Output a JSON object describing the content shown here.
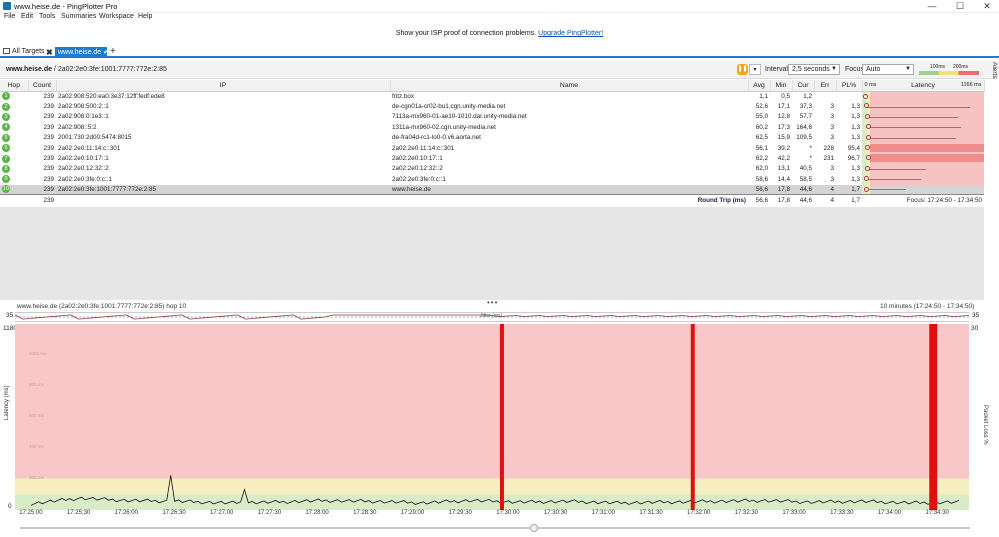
{
  "window": {
    "title": "www.heise.de - PingPlotter Pro",
    "min_glyph": "—",
    "max_glyph": "☐",
    "close_glyph": "✕"
  },
  "menu": [
    "File",
    "Edit",
    "Tools",
    "Summaries",
    "Workspace",
    "Help"
  ],
  "banner": {
    "text": "Show your ISP proof of connection problems.",
    "link": "Upgrade PingPlotter!"
  },
  "tabs": {
    "all_targets": "All Targets",
    "active": "www.heise.de",
    "add": "+"
  },
  "target": {
    "host": "www.heise.de",
    "path": " / 2a02:2e0:3fe:1001:7777:772e:2:85"
  },
  "controls": {
    "interval_label": "Interval",
    "interval_value": "2,5 seconds",
    "focus_label": "Focus",
    "focus_value": "Auto",
    "scale_100": "100ms",
    "scale_200": "200ms",
    "alerts": "Alerts"
  },
  "table": {
    "headers": {
      "hop": "Hop",
      "count": "Count",
      "ip": "IP",
      "name": "Name",
      "avg": "Avg",
      "min": "Min",
      "cur": "Cur",
      "err": "Err",
      "pl": "PL%",
      "lat_min": "0 ms",
      "latency": "Latency",
      "lat_max": "1166 ms"
    },
    "rows": [
      {
        "hop": "1",
        "count": "239",
        "ip": "2a02:908:520:ea0:3e37:12ff:fedf:ede8",
        "name": "fritz.box",
        "avg": "1,1",
        "min": "0,5",
        "cur": "1,2",
        "err": "",
        "pl": ""
      },
      {
        "hop": "2",
        "count": "239",
        "ip": "2a02:908:500:2::1",
        "name": "de-cgn01a-cr02-bu1.cgn.unity-media.net",
        "avg": "52,6",
        "min": "17,1",
        "cur": "37,3",
        "err": "3",
        "pl": "1,3"
      },
      {
        "hop": "3",
        "count": "239",
        "ip": "2a02:908:0:1e3::1",
        "name": "7113a-mx960-01-ae10-1010.dar.unity-media.net",
        "avg": "55,0",
        "min": "12,8",
        "cur": "57,7",
        "err": "3",
        "pl": "1,3"
      },
      {
        "hop": "4",
        "count": "239",
        "ip": "2a02:908::5:2",
        "name": "1311a-mx960-02.cgn.unity-media.net",
        "avg": "60,2",
        "min": "17,3",
        "cur": "164,6",
        "err": "3",
        "pl": "1,3"
      },
      {
        "hop": "5",
        "count": "239",
        "ip": "2001:730:2d00:5474:8015",
        "name": "de-fra04d-rc1-lo0-0.v6.aorta.net",
        "avg": "62,5",
        "min": "15,9",
        "cur": "109,5",
        "err": "3",
        "pl": "1,3"
      },
      {
        "hop": "6",
        "count": "239",
        "ip": "2a02:2e0:11:14:c::301",
        "name": "2a02:2e0:11:14:c::301",
        "avg": "56,1",
        "min": "39,2",
        "cur": "*",
        "err": "228",
        "pl": "95,4"
      },
      {
        "hop": "7",
        "count": "239",
        "ip": "2a02:2e0:10:17::1",
        "name": "2a02:2e0:10:17::1",
        "avg": "62,2",
        "min": "42,2",
        "cur": "*",
        "err": "231",
        "pl": "96,7"
      },
      {
        "hop": "8",
        "count": "239",
        "ip": "2a02:2e0:12:32::2",
        "name": "2a02:2e0:12:32::2",
        "avg": "62,0",
        "min": "13,1",
        "cur": "40,5",
        "err": "3",
        "pl": "1,3"
      },
      {
        "hop": "9",
        "count": "239",
        "ip": "2a02:2e0:3fe:0:c::1",
        "name": "2a02:2e0:3fe:0:c::1",
        "avg": "58,6",
        "min": "14,4",
        "cur": "58,5",
        "err": "3",
        "pl": "1,3"
      },
      {
        "hop": "10",
        "count": "239",
        "ip": "2a02:2e0:3fe:1001:7777:772e:2:85",
        "name": "www.heise.de",
        "avg": "56,6",
        "min": "17,8",
        "cur": "44,6",
        "err": "4",
        "pl": "1,7"
      }
    ],
    "summary": {
      "count": "239",
      "label": "Round Trip (ms)",
      "avg": "56,6",
      "min": "17,8",
      "cur": "44,6",
      "err": "4",
      "pl": "1,7",
      "focus": "Focus: 17:24:50 - 17:34:50"
    }
  },
  "timeline": {
    "title": "www.heise.de (2a02:2e0:3fe:1001:7777:772e:2:85) hop 10",
    "range": "10 minutes (17:24:50 - 17:34:50)",
    "jitter_max": "35",
    "jitter_label": "Jitter (ms)",
    "y_max": "1180",
    "y_min": "0",
    "y_label": "Latency (ms)",
    "pl_max": "30",
    "pl_label": "Packet Loss %",
    "grid_labels": [
      "1180 ms",
      "1000 ms",
      "800 ms",
      "600 ms",
      "400 ms",
      "200 ms"
    ],
    "x_ticks": [
      "17:25:00",
      "17:25:30",
      "17:26:00",
      "17:26:30",
      "17:27:00",
      "17:27:30",
      "17:28:00",
      "17:28:30",
      "17:29:00",
      "17:29:30",
      "17:30:00",
      "17:30:30",
      "17:31:00",
      "17:31:30",
      "17:32:00",
      "17:32:30",
      "17:33:00",
      "17:33:30",
      "17:34:00",
      "17:34:30"
    ]
  },
  "chart_data": {
    "type": "area",
    "title": "www.heise.de (2a02:2e0:3fe:1001:7777:772e:2:85) hop 10",
    "xlabel": "",
    "ylabel": "Latency (ms)",
    "ylim": [
      0,
      1180
    ],
    "y2label": "Packet Loss %",
    "y2lim": [
      0,
      30
    ],
    "x": [
      "17:25:00",
      "17:25:30",
      "17:26:00",
      "17:26:30",
      "17:27:00",
      "17:27:30",
      "17:28:00",
      "17:28:30",
      "17:29:00",
      "17:29:30",
      "17:30:00",
      "17:30:30",
      "17:31:00",
      "17:31:30",
      "17:32:00",
      "17:32:30",
      "17:33:00",
      "17:33:30",
      "17:34:00",
      "17:34:30"
    ],
    "series": [
      {
        "name": "Latency (ms)",
        "values": [
          40,
          75,
          60,
          55,
          45,
          50,
          60,
          55,
          45,
          60,
          50,
          55,
          45,
          50,
          55,
          60,
          50,
          55,
          45,
          50
        ]
      }
    ],
    "packet_loss_events": [
      {
        "time": "17:29:55",
        "value": 30
      },
      {
        "time": "17:31:55",
        "value": 30
      },
      {
        "time": "17:34:25",
        "value": 30
      }
    ],
    "colors": {
      "bad": "#f8c8c8",
      "warn": "#f7efc0",
      "good": "#d8ecc8",
      "loss": "#e01010"
    }
  }
}
